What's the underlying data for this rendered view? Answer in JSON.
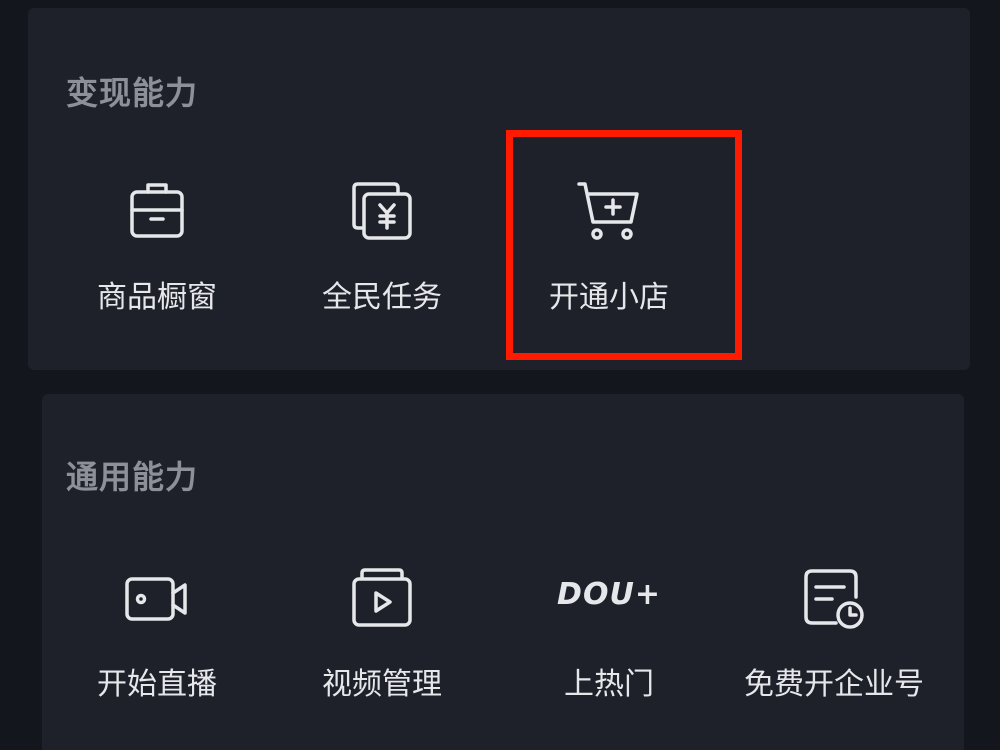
{
  "monetize": {
    "title": "变现能力",
    "items": [
      {
        "label": "商品橱窗",
        "icon": "shop-window-icon"
      },
      {
        "label": "全民任务",
        "icon": "yuan-task-icon"
      },
      {
        "label": "开通小店",
        "icon": "cart-plus-icon"
      }
    ]
  },
  "general": {
    "title": "通用能力",
    "items": [
      {
        "label": "开始直播",
        "icon": "video-camera-icon"
      },
      {
        "label": "视频管理",
        "icon": "video-manage-icon"
      },
      {
        "label": "上热门",
        "icon": "dou-plus-icon",
        "icon_text": "DOU+"
      },
      {
        "label": "免费开企业号",
        "icon": "enterprise-account-icon"
      }
    ]
  },
  "colors": {
    "background": "#14161d",
    "card": "#1e212a",
    "highlight": "#ff1a00",
    "text": "#e6e7ea",
    "section_title": "#8d9099"
  }
}
